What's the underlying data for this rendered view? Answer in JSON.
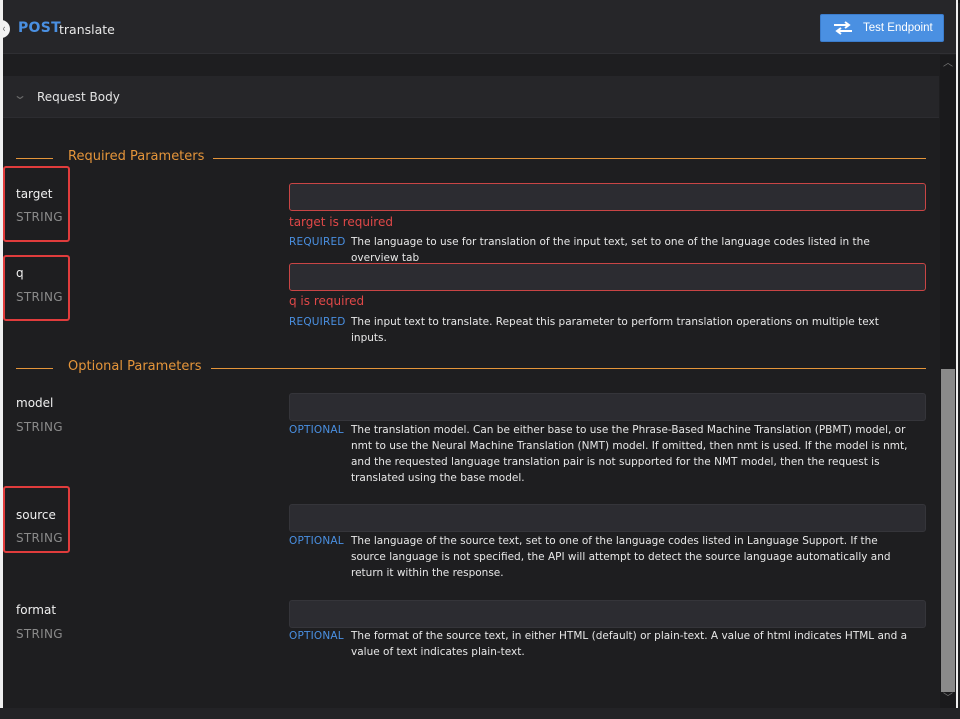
{
  "header": {
    "back_icon": "chevron-left-icon",
    "method": "POST",
    "endpoint": "translate",
    "test_button_label": "Test Endpoint",
    "test_button_icon": "swap-arrows-icon"
  },
  "request_body": {
    "label": "Request Body",
    "toggle_icon": "chevron-down-icon"
  },
  "required_section": {
    "title": "Required Parameters",
    "params": [
      {
        "name": "target",
        "type": "STRING",
        "value": "",
        "error": "target is required",
        "badge": "REQUIRED",
        "description": "The language to use for translation of the input text, set to one of the language codes listed in the overview tab"
      },
      {
        "name": "q",
        "type": "STRING",
        "value": "",
        "error": "q is required",
        "badge": "REQUIRED",
        "description": "The input text to translate. Repeat this parameter to perform translation operations on multiple text inputs."
      }
    ]
  },
  "optional_section": {
    "title": "Optional Parameters",
    "params": [
      {
        "name": "model",
        "type": "STRING",
        "value": "",
        "badge": "OPTIONAL",
        "description": "The translation model. Can be either base to use the Phrase-Based Machine Translation (PBMT) model, or nmt to use the Neural Machine Translation (NMT) model. If omitted, then nmt is used. If the model is nmt, and the requested language translation pair is not supported for the NMT model, then the request is translated using the base model."
      },
      {
        "name": "source",
        "type": "STRING",
        "value": "",
        "badge": "OPTIONAL",
        "description": "The language of the source text, set to one of the language codes listed in Language Support. If the source language is not specified, the API will attempt to detect the source language automatically and return it within the response."
      },
      {
        "name": "format",
        "type": "STRING",
        "value": "",
        "badge": "OPTIONAL",
        "description": "The format of the source text, in either HTML (default) or plain-text. A value of html indicates HTML and a value of text indicates plain-text."
      }
    ]
  },
  "colors": {
    "accent_blue": "#4a90e2",
    "section_orange": "#e5953a",
    "error_red": "#e04848",
    "highlight_red": "#e03c3c",
    "background": "#1e1e20"
  }
}
